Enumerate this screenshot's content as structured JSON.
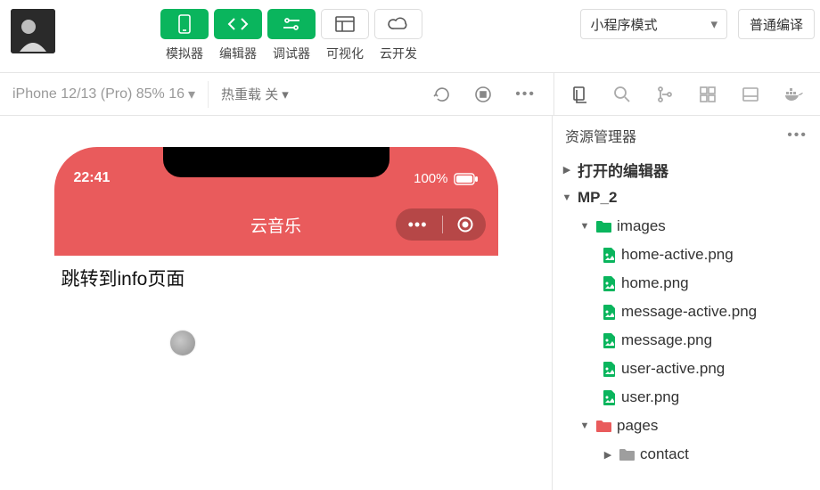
{
  "toolbar": {
    "simulator": "模拟器",
    "editor": "编辑器",
    "debugger": "调试器",
    "visualize": "可视化",
    "cloud": "云开发",
    "mode": "小程序模式",
    "compile": "普通编译"
  },
  "subbar": {
    "device": "iPhone 12/13 (Pro) 85% 16",
    "hot_reload": "热重载 关"
  },
  "phone": {
    "time": "22:41",
    "battery": "100%",
    "title": "云音乐",
    "link_text": "跳转到info页面"
  },
  "explorer": {
    "title": "资源管理器",
    "open_editors": "打开的编辑器",
    "project": "MP_2",
    "images_folder": "images",
    "files": {
      "home_active": "home-active.png",
      "home": "home.png",
      "message_active": "message-active.png",
      "message": "message.png",
      "user_active": "user-active.png",
      "user": "user.png"
    },
    "pages_folder": "pages",
    "contact_folder": "contact"
  }
}
